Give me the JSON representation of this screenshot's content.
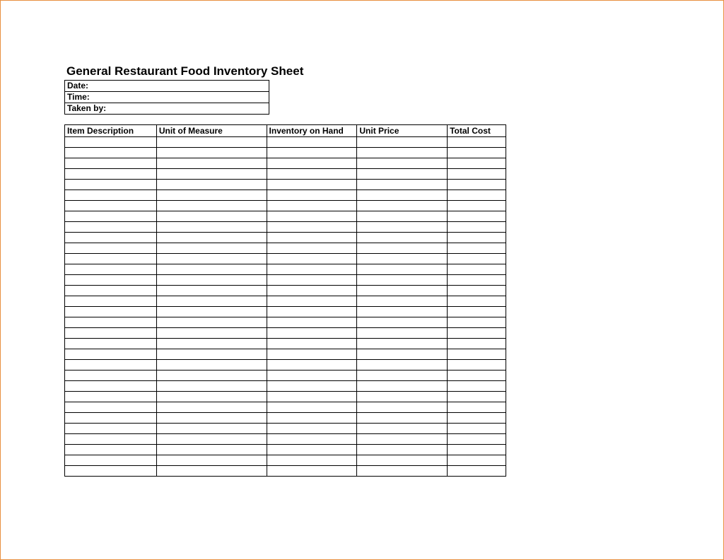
{
  "title": "General Restaurant Food Inventory Sheet",
  "meta": {
    "date_label": "Date:",
    "time_label": "Time:",
    "taken_by_label": "Taken by:"
  },
  "columns": {
    "item_description": "Item Description",
    "unit_of_measure": "Unit of Measure",
    "inventory_on_hand": "Inventory on Hand",
    "unit_price": "Unit Price",
    "total_cost": "Total Cost"
  },
  "row_count": 32
}
